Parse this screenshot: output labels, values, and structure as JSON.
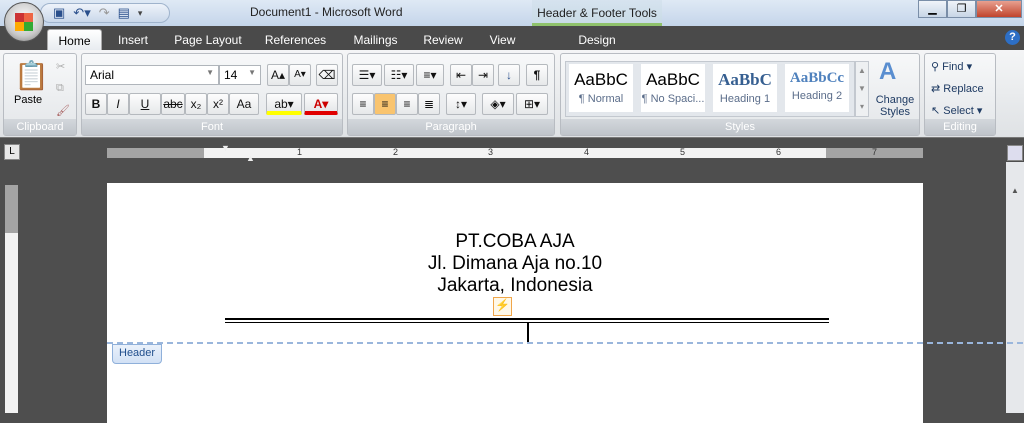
{
  "window": {
    "title": "Document1 - Microsoft Word",
    "contextual_tab_group": "Header & Footer Tools"
  },
  "tabs": [
    {
      "label": "Home"
    },
    {
      "label": "Insert"
    },
    {
      "label": "Page Layout"
    },
    {
      "label": "References"
    },
    {
      "label": "Mailings"
    },
    {
      "label": "Review"
    },
    {
      "label": "View"
    },
    {
      "label": "Design"
    }
  ],
  "clipboard": {
    "paste": "Paste",
    "label": "Clipboard"
  },
  "font": {
    "name": "Arial",
    "size": "14",
    "label": "Font",
    "bold": "B",
    "italic": "I",
    "underline": "U",
    "strike": "abc",
    "sub": "x₂",
    "sup": "x²",
    "case": "Aa",
    "grow": "A▴",
    "shrink": "A▾"
  },
  "paragraph": {
    "label": "Paragraph",
    "pilcrow": "¶"
  },
  "styles": {
    "label": "Styles",
    "items": [
      {
        "sample": "AaBbC",
        "name": "¶ Normal"
      },
      {
        "sample": "AaBbC",
        "name": "¶ No Spaci..."
      },
      {
        "sample": "AaBbC",
        "name": "Heading 1"
      },
      {
        "sample": "AaBbCc",
        "name": "Heading 2"
      }
    ],
    "change": "Change Styles"
  },
  "editing": {
    "label": "Editing",
    "find": "Find",
    "replace": "Replace",
    "select": "Select"
  },
  "ruler": {
    "numbers": [
      "1",
      "2",
      "3",
      "4",
      "5",
      "6",
      "7"
    ]
  },
  "document": {
    "header_lines": [
      "PT.COBA AJA",
      "Jl. Dimana Aja no.10",
      "Jakarta, Indonesia"
    ],
    "header_tag": "Header"
  },
  "colors": {
    "highlight": "#ffff00",
    "font_color": "#e00000",
    "accent": "#f7c36b"
  }
}
